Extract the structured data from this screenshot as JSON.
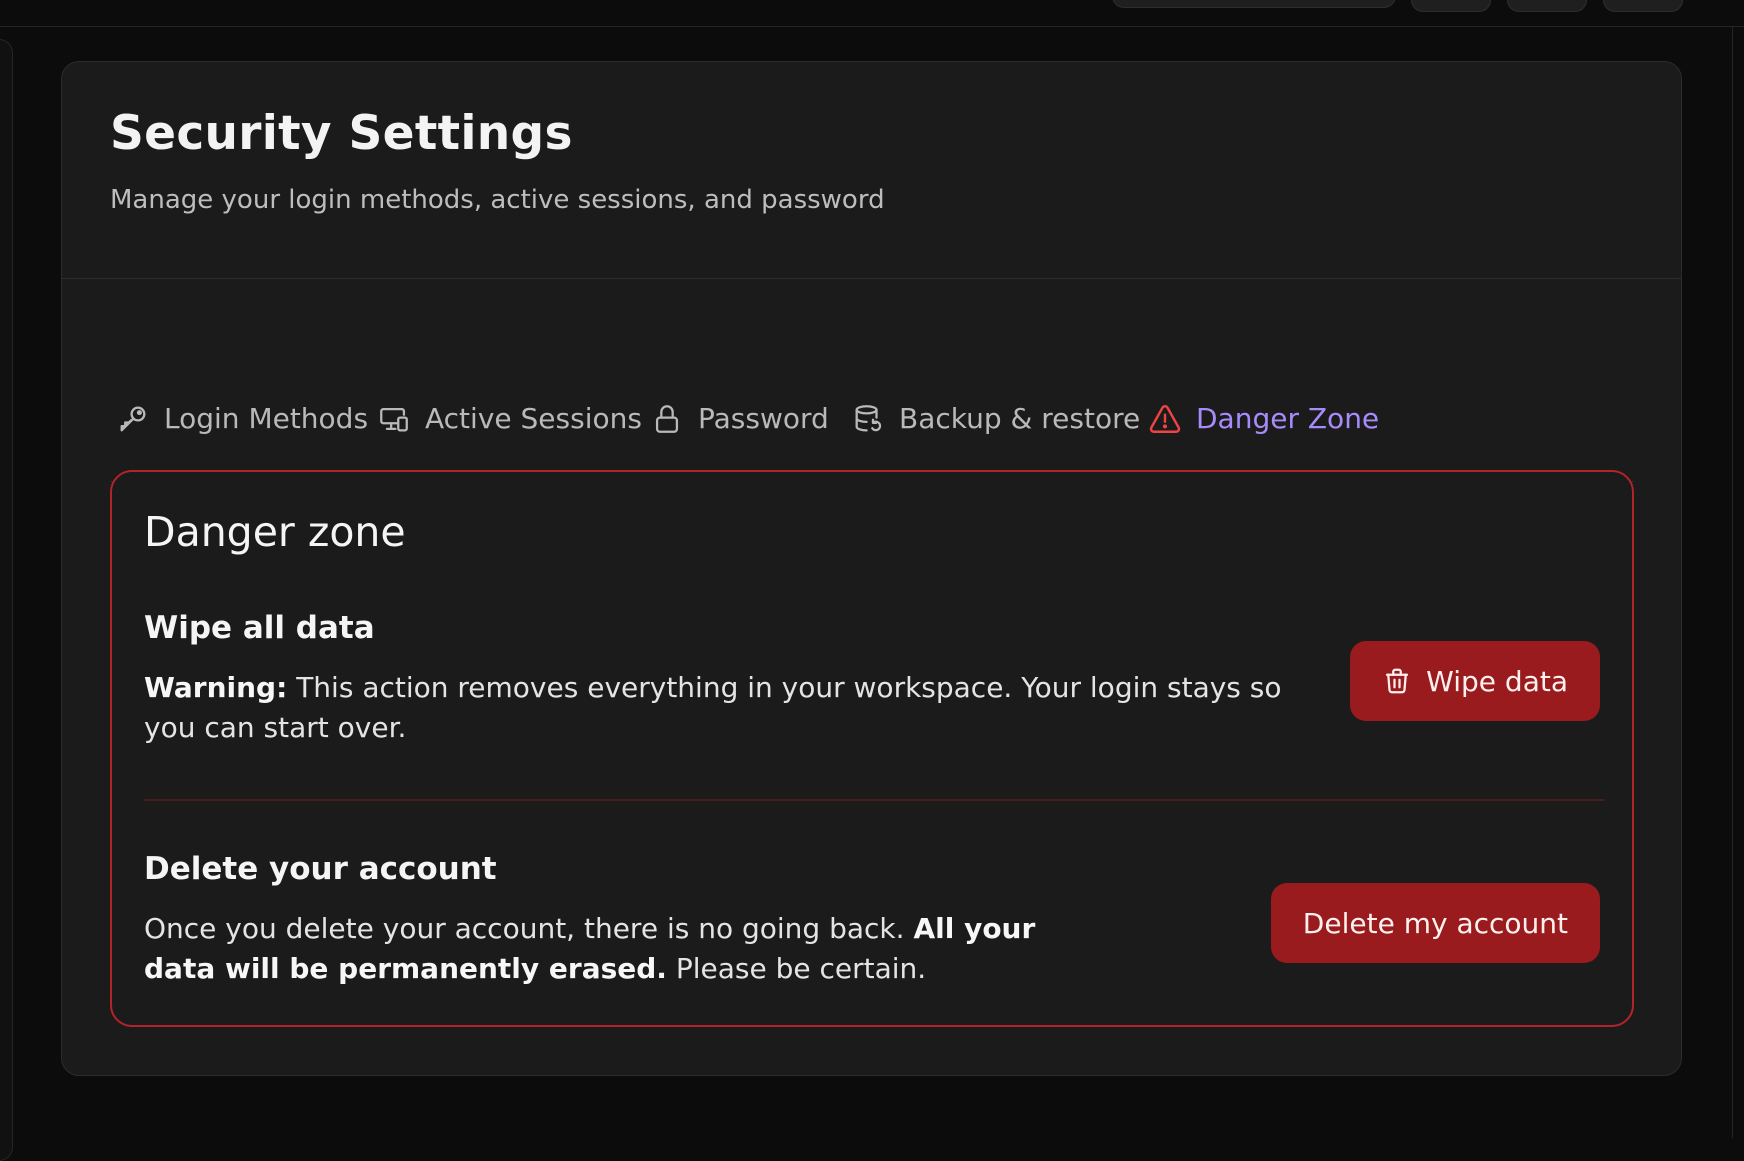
{
  "header": {
    "title": "Security Settings",
    "subtitle": "Manage your login methods, active sessions, and password"
  },
  "tabs": [
    {
      "label": "Login Methods",
      "icon": "key-icon"
    },
    {
      "label": "Active Sessions",
      "icon": "devices-icon"
    },
    {
      "label": "Password",
      "icon": "lock-icon"
    },
    {
      "label": "Backup & restore",
      "icon": "database-restore-icon"
    },
    {
      "label": "Danger Zone",
      "icon": "warning-triangle-icon",
      "active": true
    }
  ],
  "danger_zone": {
    "title": "Danger zone",
    "wipe": {
      "title": "Wipe all data",
      "warning_label": "Warning:",
      "description": " This action removes everything in your workspace. Your login stays so you can start over.",
      "button_label": "Wipe data",
      "button_icon": "trash-icon"
    },
    "delete": {
      "title": "Delete your account",
      "description_start": "Once you delete your account, there is no going back. ",
      "description_bold": "All your data will be permanently erased.",
      "description_end": " Please be certain.",
      "button_label": "Delete my account"
    }
  },
  "colors": {
    "accent": "#a78bfa",
    "danger": "#991b1e",
    "danger_border": "#b3232a",
    "card_bg": "#1b1b1b",
    "page_bg": "#0c0c0c"
  }
}
